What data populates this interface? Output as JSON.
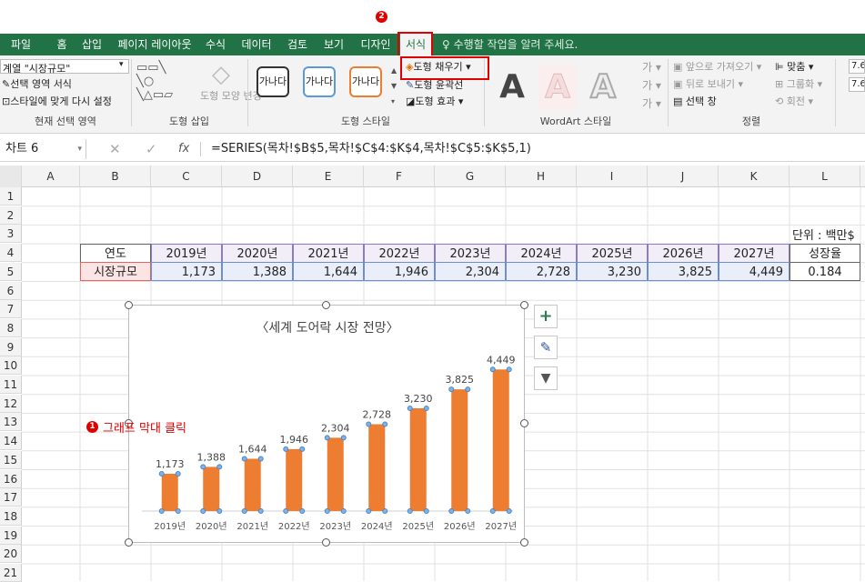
{
  "tabs": [
    "파일",
    "홈",
    "삽입",
    "페이지 레이아웃",
    "수식",
    "데이터",
    "검토",
    "보기",
    "디자인",
    "서식"
  ],
  "tell_me": "수행할 작업을 알려 주세요.",
  "ribbon": {
    "current_selection": {
      "dropdown": "계열 \"시장규모\"",
      "format_selection": "선택 영역 서식",
      "reset_style": "스타일에 맞게 다시 설정",
      "label": "현재 선택 영역"
    },
    "insert_shapes": {
      "change_shape": "도형 모양 변경",
      "label": "도형 삽입"
    },
    "shape_styles": {
      "samples": [
        "가나다",
        "가나다",
        "가나다"
      ],
      "fill": "도형 채우기",
      "outline": "도형 윤곽선",
      "effects": "도형 효과",
      "label": "도형 스타일"
    },
    "wordart": {
      "letters": [
        "A",
        "A",
        "A"
      ],
      "label": "WordArt 스타일"
    },
    "arrange": {
      "bring_forward": "앞으로 가져오기",
      "send_backward": "뒤로 보내기",
      "selection_pane": "선택 창",
      "align": "맞춤",
      "group": "그룹화",
      "rotate": "회전",
      "label": "정렬"
    },
    "size_partial": "7.6"
  },
  "formula_bar": {
    "name_box": "차트 6",
    "fx": "fx",
    "formula": "=SERIES(목차!$B$5,목차!$C$4:$K$4,목차!$C$5:$K$5,1)"
  },
  "columns": [
    "A",
    "B",
    "C",
    "D",
    "E",
    "F",
    "G",
    "H",
    "I",
    "J",
    "K",
    "L"
  ],
  "rows": [
    "1",
    "2",
    "3",
    "4",
    "5",
    "6",
    "7",
    "8",
    "9",
    "10",
    "11",
    "12",
    "13",
    "14",
    "15",
    "16",
    "17",
    "18",
    "19",
    "20",
    "21"
  ],
  "sheet": {
    "unit": "단위 : 백만$",
    "header_label": "연도",
    "row_label": "시장규모",
    "years": [
      "2019년",
      "2020년",
      "2021년",
      "2022년",
      "2023년",
      "2024년",
      "2025년",
      "2026년",
      "2027년"
    ],
    "values": [
      "1,173",
      "1,388",
      "1,644",
      "1,946",
      "2,304",
      "2,728",
      "3,230",
      "3,825",
      "4,449"
    ],
    "growth_label": "성장율",
    "growth_value": "0.184"
  },
  "chart_data": {
    "type": "bar",
    "title": "〈세계 도어락 시장 전망〉",
    "categories": [
      "2019년",
      "2020년",
      "2021년",
      "2022년",
      "2023년",
      "2024년",
      "2025년",
      "2026년",
      "2027년"
    ],
    "values": [
      1173,
      1388,
      1644,
      1946,
      2304,
      2728,
      3230,
      3825,
      4449
    ],
    "data_labels": [
      "1,173",
      "1,388",
      "1,644",
      "1,946",
      "2,304",
      "2,728",
      "3,230",
      "3,825",
      "4,449"
    ],
    "ylim": [
      0,
      4800
    ],
    "bar_color": "#ed7d31",
    "grid": false
  },
  "annotations": {
    "step1_number": "1",
    "step1_text": "그래프 막대 클릭",
    "step2_number": "2",
    "highlight_color": "#e00000"
  }
}
